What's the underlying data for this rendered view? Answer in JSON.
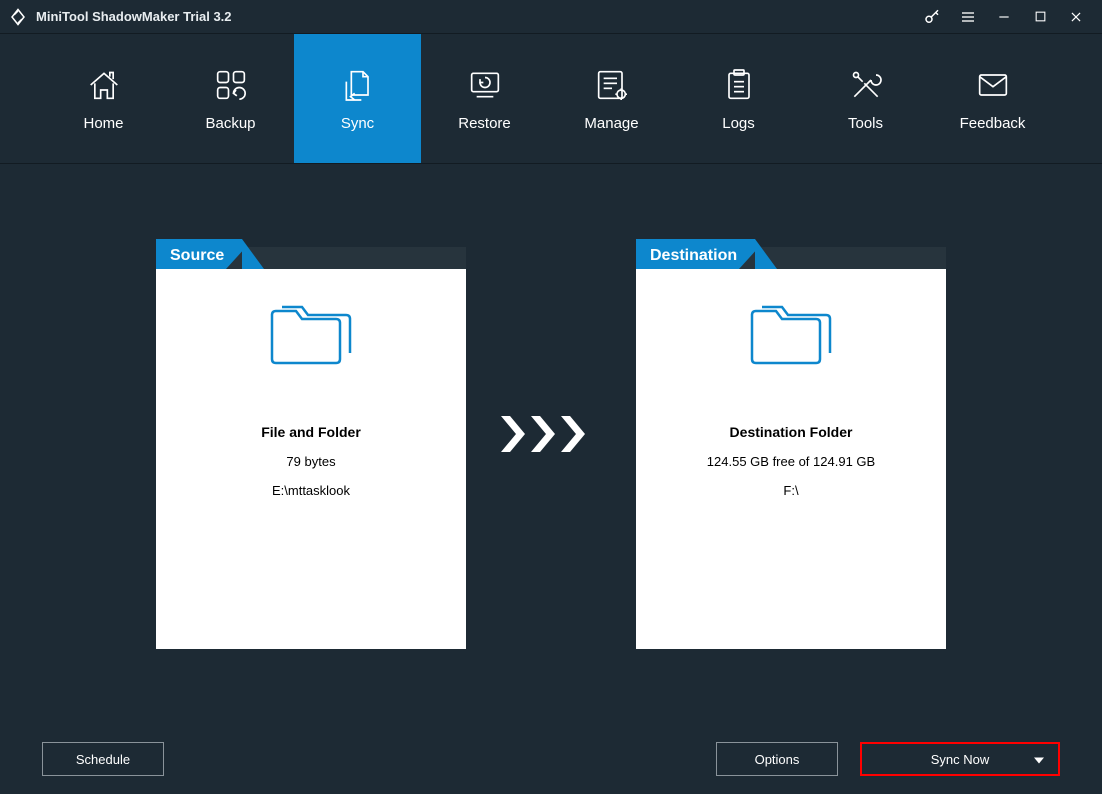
{
  "titlebar": {
    "title": "MiniTool ShadowMaker Trial 3.2"
  },
  "nav": {
    "items": [
      {
        "label": "Home"
      },
      {
        "label": "Backup"
      },
      {
        "label": "Sync"
      },
      {
        "label": "Restore"
      },
      {
        "label": "Manage"
      },
      {
        "label": "Logs"
      },
      {
        "label": "Tools"
      },
      {
        "label": "Feedback"
      }
    ],
    "activeIndex": 2
  },
  "source": {
    "tabLabel": "Source",
    "title": "File and Folder",
    "size": "79 bytes",
    "path": "E:\\mttasklook"
  },
  "destination": {
    "tabLabel": "Destination",
    "title": "Destination Folder",
    "size": "124.55 GB free of 124.91 GB",
    "path": "F:\\"
  },
  "footer": {
    "schedule": "Schedule",
    "options": "Options",
    "syncnow": "Sync Now"
  },
  "colors": {
    "accent": "#0d87cd",
    "bg": "#1d2a34",
    "highlight": "#ff0000"
  }
}
